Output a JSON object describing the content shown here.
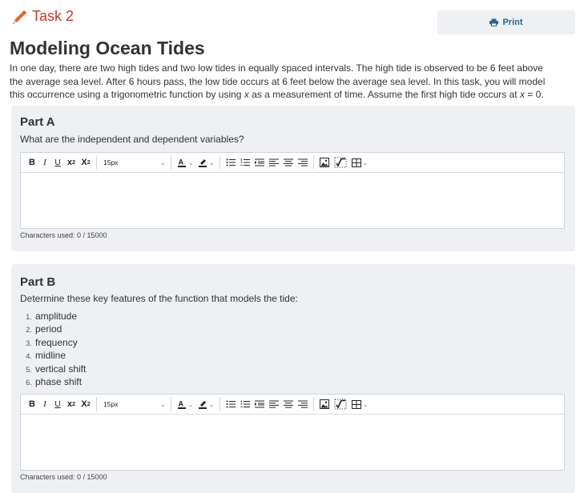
{
  "task": {
    "title": "Task 2",
    "icon": "pencil-icon"
  },
  "print": {
    "label": "Print",
    "icon": "printer-icon"
  },
  "page_title": "Modeling Ocean Tides",
  "intro": {
    "line1": "In one day, there are two high tides and two low tides in equally spaced intervals. The high tide is observed to be 6 feet above",
    "line2": "the average sea level. After 6 hours pass, the low tide occurs at 6 feet below the average sea level. In this task, you will model",
    "line3_pre": "this occurrence using a trigonometric function by using ",
    "var_x": "x",
    "line3_mid": " as a measurement of time. Assume the first high tide occurs at ",
    "line3_post": " = 0."
  },
  "part_a": {
    "title": "Part A",
    "prompt": "What are the independent and dependent variables?",
    "chars": "Characters used: 0 / 15000"
  },
  "part_b": {
    "title": "Part B",
    "prompt": "Determine these key features of the function that models the tide:",
    "items": [
      {
        "num": "1.",
        "text": "amplitude"
      },
      {
        "num": "2.",
        "text": "period"
      },
      {
        "num": "3.",
        "text": "frequency"
      },
      {
        "num": "4.",
        "text": "midline"
      },
      {
        "num": "5.",
        "text": "vertical shift"
      },
      {
        "num": "6.",
        "text": "phase shift"
      }
    ],
    "chars": "Characters used: 0 / 15000"
  },
  "toolbar": {
    "bold": "B",
    "italic": "I",
    "underline": "U",
    "superscript": "x",
    "superscript_mark": "2",
    "subscript": "X",
    "subscript_mark": "2",
    "font_size": "15px"
  },
  "colors": {
    "accent_red": "#c0392b",
    "link_blue": "#2a6496",
    "panel_bg": "#eef0f3"
  }
}
